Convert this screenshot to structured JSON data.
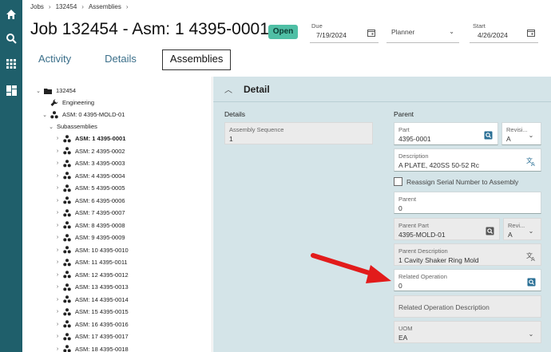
{
  "breadcrumb": [
    "Jobs",
    "132454",
    "Assemblies"
  ],
  "page_title": "Job 132454 - Asm: 1 4395-0001",
  "status_badge": "Open",
  "header": {
    "due_label": "Due",
    "due_value": "7/19/2024",
    "planner_label": "Planner",
    "start_label": "Start",
    "start_value": "4/26/2024"
  },
  "tabs": [
    "Activity",
    "Details",
    "Assemblies"
  ],
  "tree": {
    "root": "132454",
    "engineering": "Engineering",
    "asm0": "ASM: 0 4395-MOLD-01",
    "subassemblies": "Subassemblies",
    "items": [
      "ASM: 1 4395-0001",
      "ASM: 2 4395-0002",
      "ASM: 3 4395-0003",
      "ASM: 4 4395-0004",
      "ASM: 5 4395-0005",
      "ASM: 6 4395-0006",
      "ASM: 7 4395-0007",
      "ASM: 8 4395-0008",
      "ASM: 9 4395-0009",
      "ASM: 10 4395-0010",
      "ASM: 11 4395-0011",
      "ASM: 12 4395-0012",
      "ASM: 13 4395-0013",
      "ASM: 14 4395-0014",
      "ASM: 15 4395-0015",
      "ASM: 16 4395-0016",
      "ASM: 17 4395-0017",
      "ASM: 18 4395-0018"
    ]
  },
  "detail": {
    "header": "Detail",
    "details_section": "Details",
    "parent_section": "Parent",
    "assembly_sequence_label": "Assembly Sequence",
    "assembly_sequence_value": "1",
    "part_label": "Part",
    "part_value": "4395-0001",
    "revision_label": "Revisi...",
    "revision_value": "A",
    "description_label": "Description",
    "description_value": "A PLATE, 420SS 50-52 Rc",
    "reassign_label": "Reassign Serial Number to Assembly",
    "parent_label": "Parent",
    "parent_value": "0",
    "parent_part_label": "Parent Part",
    "parent_part_value": "4395-MOLD-01",
    "parent_rev_label": "Revi...",
    "parent_rev_value": "A",
    "parent_desc_label": "Parent Description",
    "parent_desc_value": "1 Cavity Shaker Ring Mold",
    "related_op_label": "Related Operation",
    "related_op_value": "0",
    "related_op_desc_label": "Related Operation Description",
    "uom_label": "UOM",
    "uom_value": "EA"
  },
  "colors": {
    "rail": "#1f5f6b",
    "badge": "#4fbfa5",
    "panel": "#d4e4e8",
    "arrow": "#e21b1b",
    "tab_link": "#3b6f8a"
  }
}
